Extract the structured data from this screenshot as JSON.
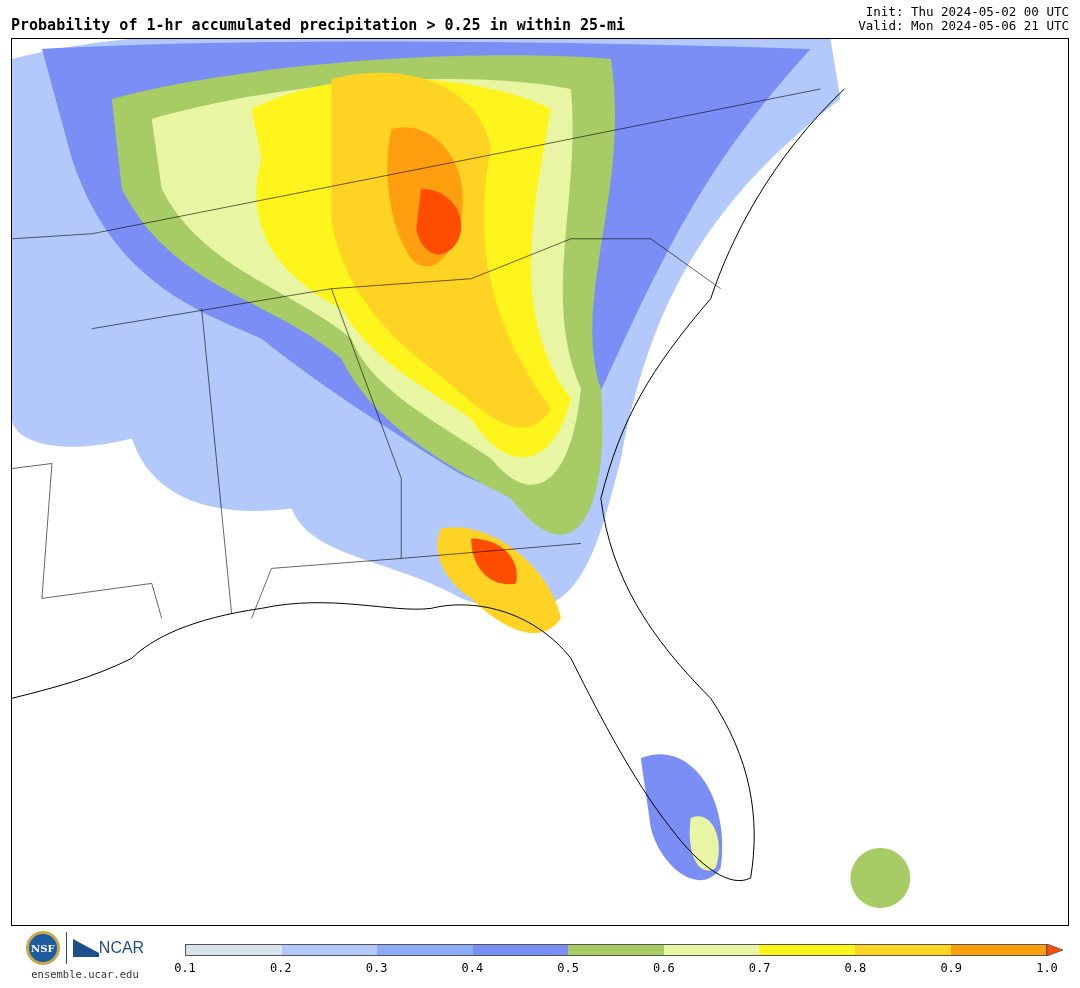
{
  "title": "Probability of 1-hr accumulated precipitation > 0.25 in within 25-mi",
  "init": "Init: Thu 2024-05-02 00 UTC",
  "valid": "Valid: Mon 2024-05-06 21 UTC",
  "logos": {
    "nsf": "NSF",
    "ncar": "NCAR",
    "url": "ensemble.ucar.edu"
  },
  "colorbar": {
    "bins": [
      {
        "color": "#d9e3ee"
      },
      {
        "color": "#b3c9fb"
      },
      {
        "color": "#8cacfa"
      },
      {
        "color": "#7a8ef5"
      },
      {
        "color": "#a7cc66"
      },
      {
        "color": "#e8f5a3"
      },
      {
        "color": "#fff51c"
      },
      {
        "color": "#ffd324"
      },
      {
        "color": "#ff9f0f"
      },
      {
        "kind": "arrow",
        "color": "#ff4d00"
      }
    ],
    "ticks": [
      "0.1",
      "0.2",
      "0.3",
      "0.4",
      "0.5",
      "0.6",
      "0.7",
      "0.8",
      "0.9",
      "1.0"
    ]
  }
}
